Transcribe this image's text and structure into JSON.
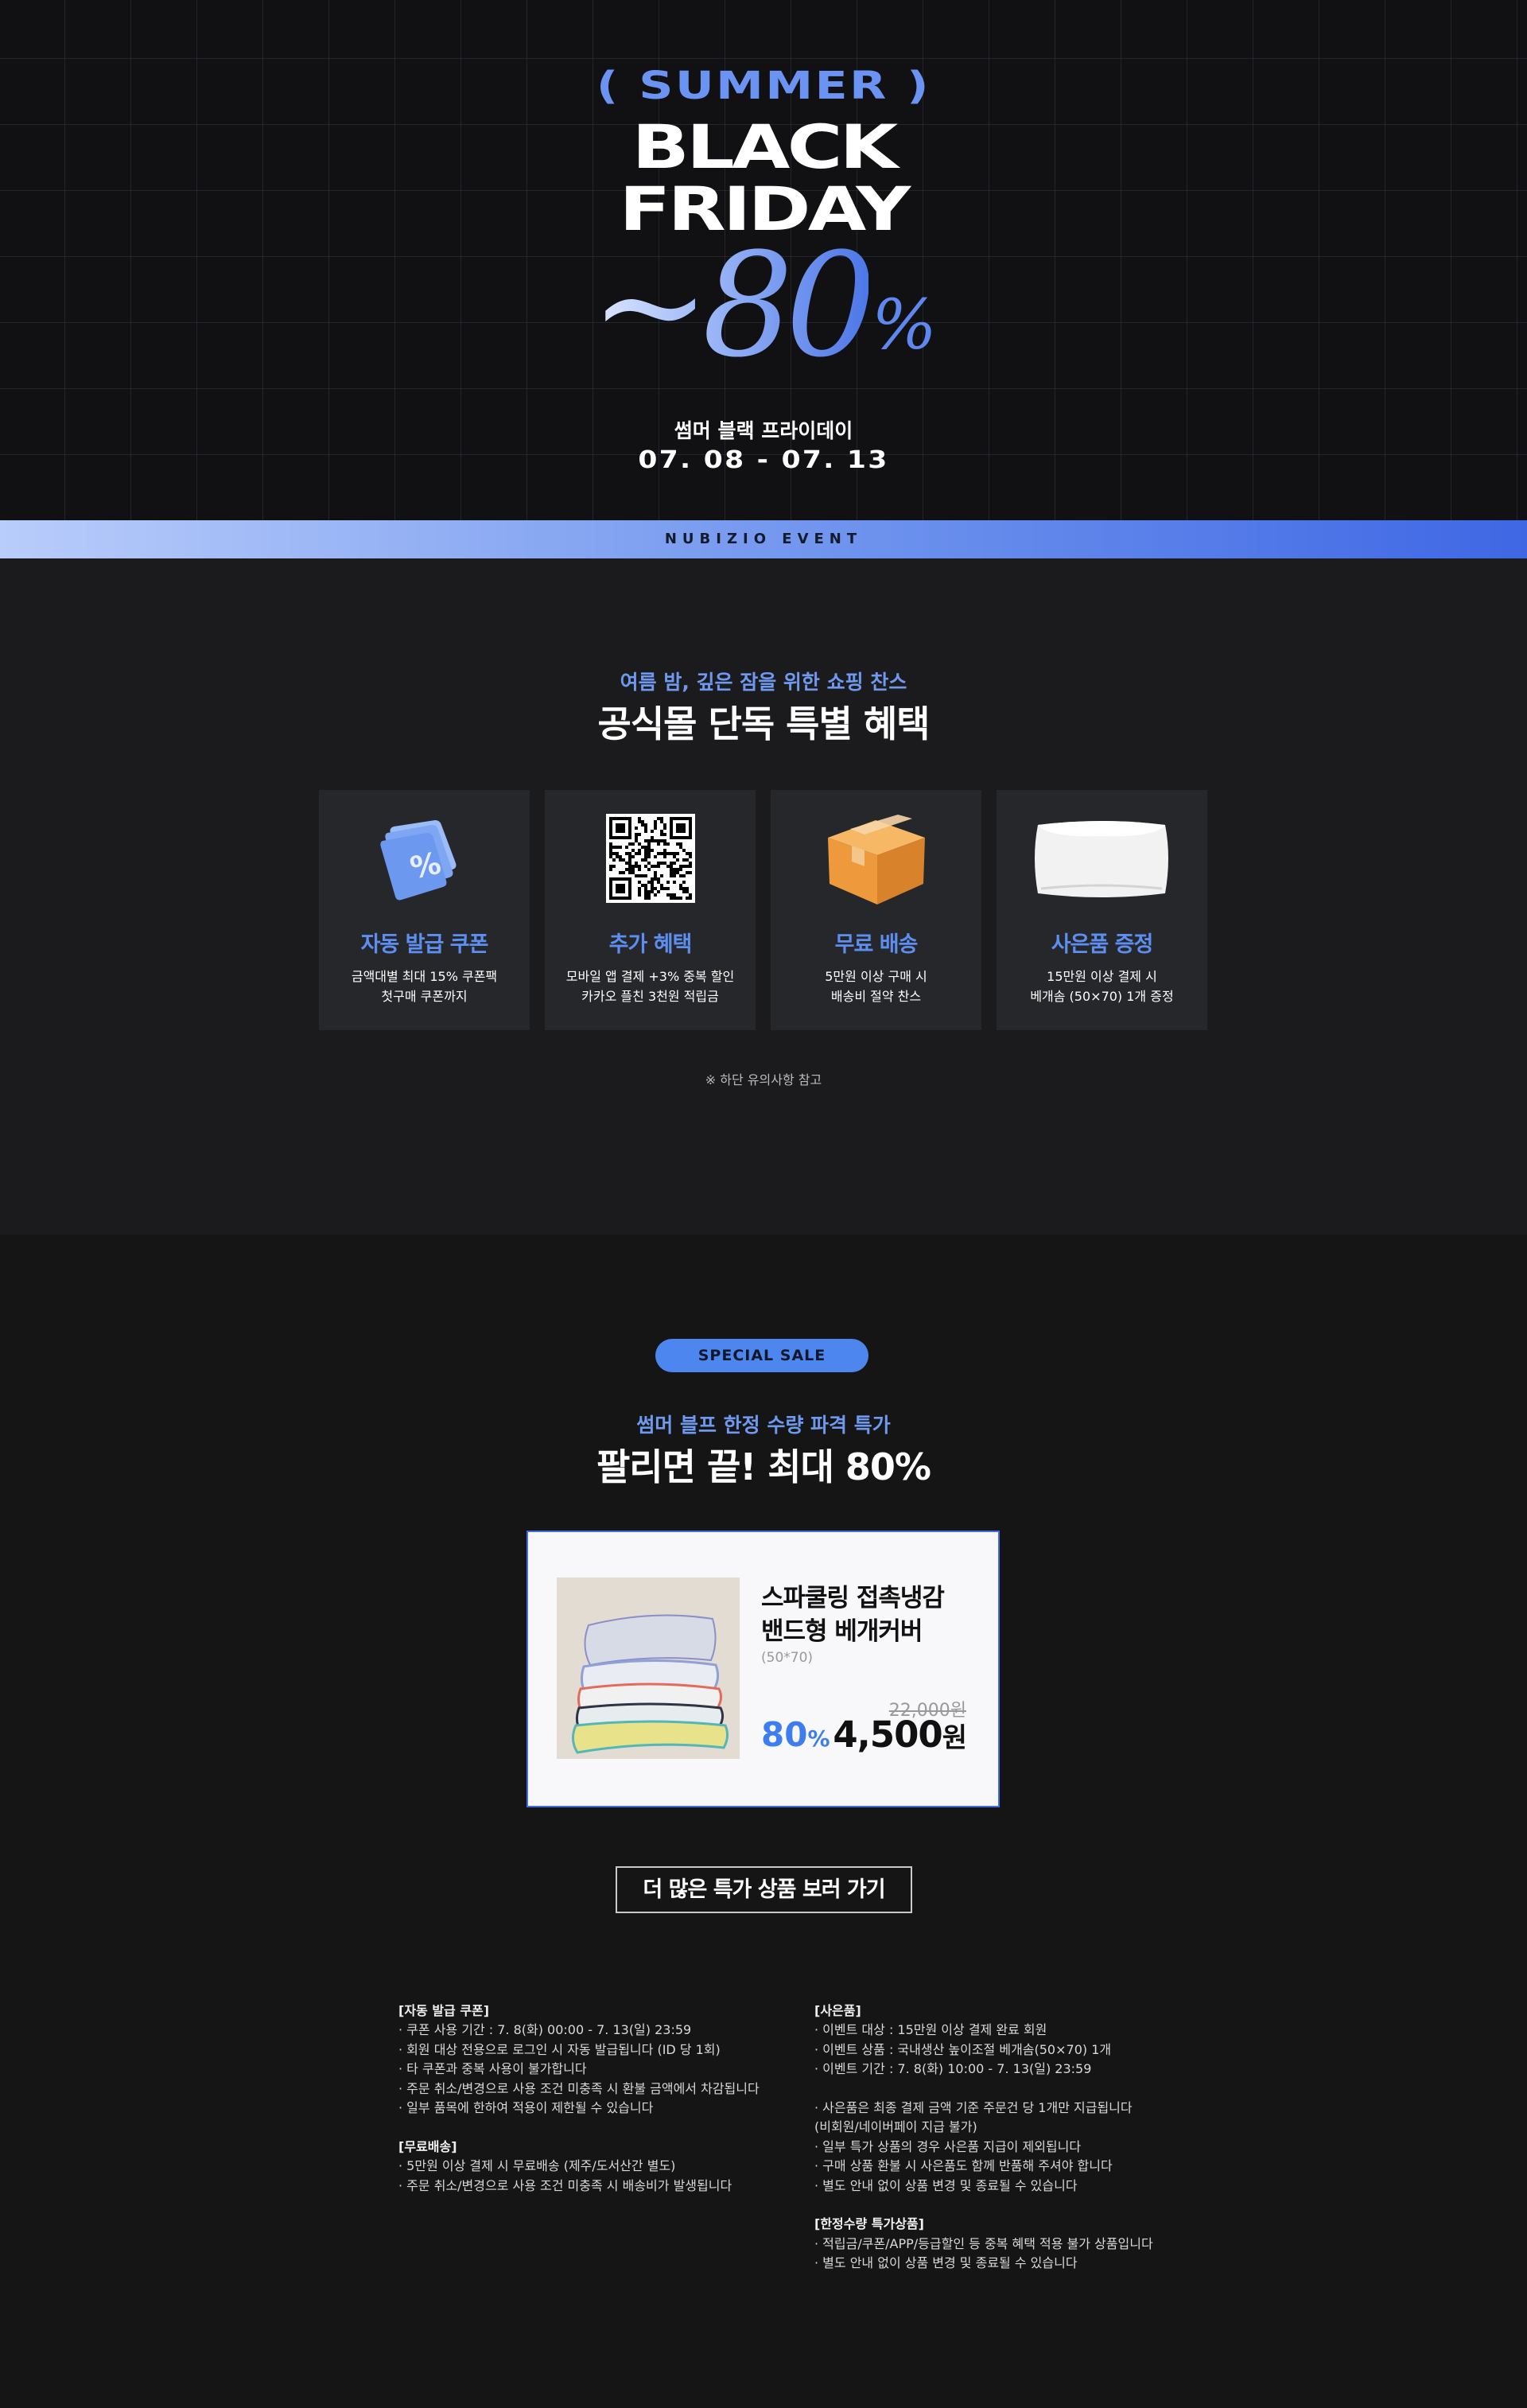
{
  "hero": {
    "summer": "( SUMMER )",
    "line1": "BLACK",
    "line2": "FRIDAY",
    "discount_prefix": "~80",
    "discount_suffix": "%",
    "subtitle": "썸머 블랙 프라이데이",
    "dates": "07. 08 - 07. 13"
  },
  "event_bar": {
    "label": "NUBIZIO EVENT"
  },
  "benefits": {
    "kicker": "여름 밤, 깊은 잠을 위한 쇼핑 찬스",
    "title": "공식몰 단독 특별 혜택",
    "cards": [
      {
        "icon": "coupon-icon",
        "title": "자동 발급 쿠폰",
        "desc1": "금액대별 최대 15% 쿠폰팩",
        "desc2": "첫구매 쿠폰까지"
      },
      {
        "icon": "qr-code-icon",
        "title": "추가 혜택",
        "desc1": "모바일 앱 결제 +3% 중복 할인",
        "desc2": "카카오 플친 3천원 적립금"
      },
      {
        "icon": "box-icon",
        "title": "무료 배송",
        "desc1": "5만원 이상 구매 시",
        "desc2": "배송비 절약 찬스"
      },
      {
        "icon": "pillow-icon",
        "title": "사은품 증정",
        "desc1": "15만원 이상 결제 시",
        "desc2": "베개솜 (50×70) 1개 증정"
      }
    ],
    "note": "※ 하단 유의사항 참고"
  },
  "special": {
    "badge": "SPECIAL SALE",
    "kicker": "썸머 블프 한정 수량 파격 특가",
    "title": "팔리면 끝! 최대 80%",
    "product": {
      "name_line1": "스파쿨링 접촉냉감",
      "name_line2": "밴드형 베개커버",
      "size": "(50*70)",
      "original_price": "22,000원",
      "discount": "80",
      "discount_unit": "%",
      "price": "4,500",
      "price_unit": "원"
    },
    "more_button": "더 많은 특가 상품 보러 가기"
  },
  "notices": {
    "left": [
      "[자동 발급 쿠폰]",
      "· 쿠폰 사용 기간 : 7. 8(화) 00:00 - 7. 13(일) 23:59",
      "· 회원 대상 전용으로 로그인 시 자동 발급됩니다 (ID 당 1회)",
      "· 타 쿠폰과 중복 사용이 불가합니다",
      "· 주문 취소/변경으로 사용 조건 미충족 시 환불 금액에서 차감됩니다",
      "· 일부 품목에 한하여 적용이 제한될 수 있습니다",
      "",
      "[무료배송]",
      "· 5만원 이상 결제 시 무료배송 (제주/도서산간 별도)",
      "· 주문 취소/변경으로 사용 조건 미충족 시 배송비가 발생됩니다"
    ],
    "right": [
      "[사은품]",
      "· 이벤트 대상 : 15만원 이상 결제 완료 회원",
      "· 이벤트 상품 : 국내생산 높이조절 베개솜(50×70) 1개",
      "· 이벤트 기간 :  7. 8(화) 10:00 - 7. 13(일) 23:59",
      "",
      "· 사은품은 최종 결제 금액 기준 주문건 당 1개만 지급됩니다",
      "  (비회원/네이버페이 지급 불가)",
      "· 일부 특가 상품의 경우 사은품 지급이 제외됩니다",
      "· 구매 상품 환불 시 사은품도 함께 반품해 주셔야 합니다",
      "· 별도 안내 없이 상품 변경 및 종료될 수 있습니다",
      "",
      "[한정수량 특가상품]",
      "· 적립금/쿠폰/APP/등급할인 등 중복 혜택 적용 불가 상품입니다",
      "· 별도 안내 없이 상품 변경 및 종료될 수 있습니다"
    ]
  },
  "colors": {
    "accent": "#4e86f0",
    "hero_bg": "#111113",
    "section_bg": "#1b1b1d"
  }
}
